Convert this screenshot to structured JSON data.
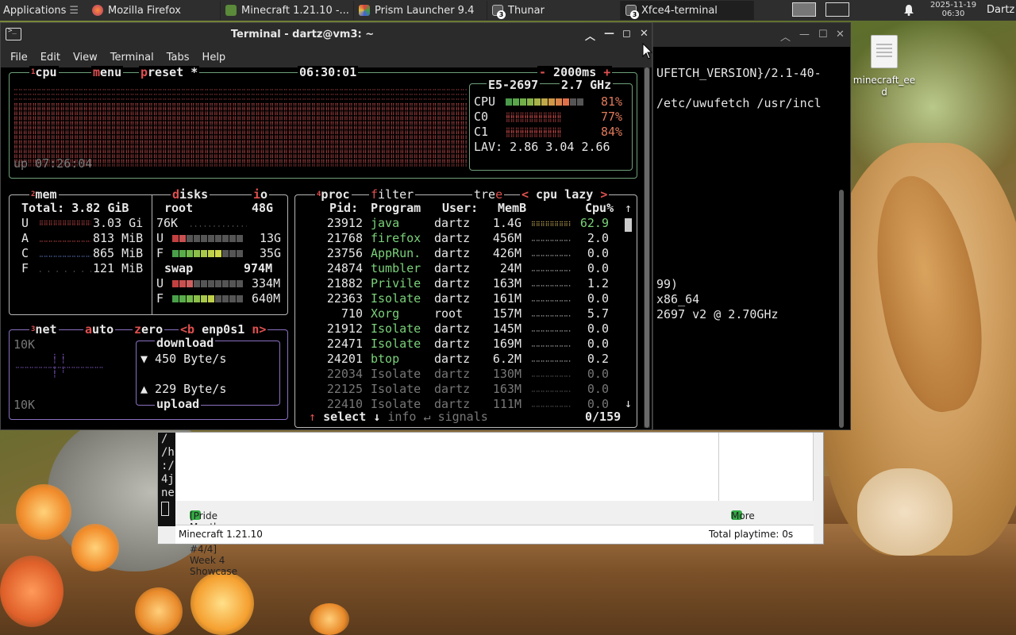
{
  "panel": {
    "applications": "Applications",
    "tasks": [
      {
        "label": "Mozilla Firefox",
        "icon": "firefox-icon"
      },
      {
        "label": "Minecraft 1.21.10 -...",
        "icon": "minecraft-icon"
      },
      {
        "label": "Prism Launcher 9.4",
        "icon": "prism-icon"
      },
      {
        "label": "Thunar",
        "icon": "terminal-icon",
        "badge": "3"
      },
      {
        "label": "Xfce4-terminal",
        "icon": "terminal-icon",
        "badge": "3"
      }
    ],
    "clock_date": "2025-11-19",
    "clock_time": "06:30",
    "user": "Dartz"
  },
  "desktop": {
    "icon_label_1": "minecraft_ee",
    "icon_label_2": "d"
  },
  "bg_terminal": {
    "lines": [
      "UFETCH_VERSION}/2.1-40-",
      "/etc/uwufetch /usr/incl",
      "99)",
      "x86_64",
      "2697 v2 @ 2.70GHz"
    ]
  },
  "prism": {
    "left_chars": [
      "/",
      "/h",
      ":/",
      "4j",
      "ne"
    ],
    "news_title": "[Pride Month 2025 #4/4] Week 4 Showcase",
    "more_news": "More news",
    "instance": "Minecraft 1.21.10",
    "playtime": "Total playtime: 0s"
  },
  "terminal": {
    "title": "Terminal - dartz@vm3: ~",
    "menu": [
      "File",
      "Edit",
      "View",
      "Terminal",
      "Tabs",
      "Help"
    ],
    "cpu_box": {
      "num": "1",
      "tabs": [
        "cpu",
        "menu",
        "preset *"
      ],
      "time": "06:30:01",
      "interval": "- 2000ms +",
      "model": "E5-2697",
      "freq": "2.7 GHz",
      "rows": [
        {
          "name": "CPU",
          "pct": "81%"
        },
        {
          "name": "C0",
          "pct": "77%"
        },
        {
          "name": "C1",
          "pct": "84%"
        }
      ],
      "lav_label": "LAV:",
      "lav": "2.86 3.04 2.66",
      "uptime": "up 07:26:04"
    },
    "mem_box": {
      "num": "2",
      "title": "mem",
      "total": "Total: 3.82 GiB",
      "rows": [
        {
          "k": "U",
          "v": "3.03 Gi"
        },
        {
          "k": "A",
          "v": "813 MiB"
        },
        {
          "k": "C",
          "v": "865 MiB"
        },
        {
          "k": "F",
          "v": "121 MiB"
        }
      ],
      "disks_title": "disks",
      "io_title": "io",
      "root_label": "root",
      "root_size": "48G",
      "root_io": "76K",
      "root_used": "13G",
      "root_free": "35G",
      "swap_label": "swap",
      "swap_size": "974M",
      "swap_used": "334M",
      "swap_free": "640M",
      "u_key": "U",
      "f_key": "F"
    },
    "net_box": {
      "num": "3",
      "title": "net",
      "auto": "auto",
      "zero": "zero",
      "iface": "<b enp0s1 n>",
      "scale_top": "10K",
      "scale_bottom": "10K",
      "download": "download",
      "down_rate": "▼ 450 Byte/s",
      "up_rate": "▲ 229 Byte/s",
      "upload": "upload"
    },
    "proc_box": {
      "num": "4",
      "title": "proc",
      "filter": "filter",
      "tree": "tree",
      "sort": "< cpu lazy >",
      "headers": [
        "Pid:",
        "Program",
        "User:",
        "MemB",
        "Cpu%"
      ],
      "rows": [
        {
          "pid": "23912",
          "prog": "java",
          "user": "dartz",
          "mem": "1.4G",
          "cpu": "62.9"
        },
        {
          "pid": "21768",
          "prog": "firefox",
          "user": "dartz",
          "mem": "456M",
          "cpu": "2.0"
        },
        {
          "pid": "23756",
          "prog": "AppRun.",
          "user": "dartz",
          "mem": "426M",
          "cpu": "0.0"
        },
        {
          "pid": "24874",
          "prog": "tumbler",
          "user": "dartz",
          "mem": "24M",
          "cpu": "0.0"
        },
        {
          "pid": "21882",
          "prog": "Privile",
          "user": "dartz",
          "mem": "163M",
          "cpu": "1.2"
        },
        {
          "pid": "22363",
          "prog": "Isolate",
          "user": "dartz",
          "mem": "161M",
          "cpu": "0.0"
        },
        {
          "pid": "710",
          "prog": "Xorg",
          "user": "root",
          "mem": "157M",
          "cpu": "5.7"
        },
        {
          "pid": "21912",
          "prog": "Isolate",
          "user": "dartz",
          "mem": "145M",
          "cpu": "0.0"
        },
        {
          "pid": "22471",
          "prog": "Isolate",
          "user": "dartz",
          "mem": "169M",
          "cpu": "0.0"
        },
        {
          "pid": "24201",
          "prog": "btop",
          "user": "dartz",
          "mem": "6.2M",
          "cpu": "0.2"
        },
        {
          "pid": "22034",
          "prog": "Isolate",
          "user": "dartz",
          "mem": "130M",
          "cpu": "0.0"
        },
        {
          "pid": "22125",
          "prog": "Isolate",
          "user": "dartz",
          "mem": "163M",
          "cpu": "0.0"
        },
        {
          "pid": "22410",
          "prog": "Isolate",
          "user": "dartz",
          "mem": "111M",
          "cpu": "0.0"
        }
      ],
      "select": "select ↓",
      "info": "info ↵",
      "signals": "signals",
      "count": "0/159"
    }
  },
  "colors": {
    "cpu_box": "#6fa07a",
    "mem_box": "#b6b6b6",
    "net_box": "#8a70c0",
    "proc_box": "#b8b8b8",
    "red_accent": "#e05050"
  }
}
